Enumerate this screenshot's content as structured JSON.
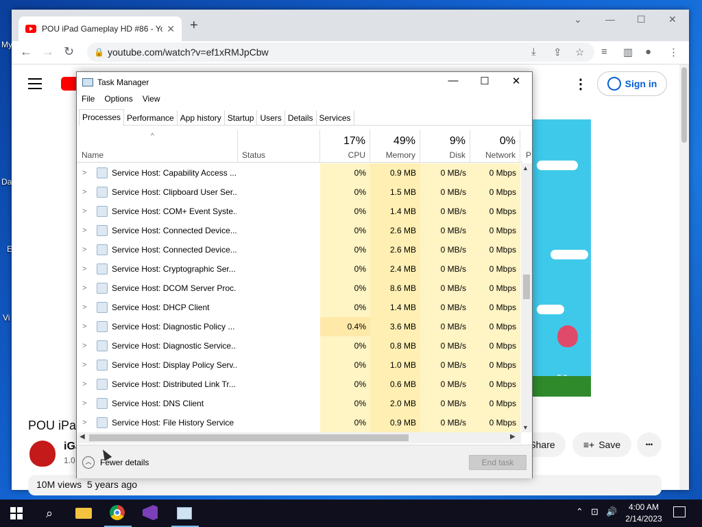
{
  "desktop": {
    "labels": [
      "My",
      "Da",
      "E",
      "Vi"
    ]
  },
  "browser": {
    "tab_title": "POU iPad Gameplay HD #86 - Yo",
    "url": "youtube.com/watch?v=ef1xRMJpCbw",
    "new_tab_symbol": "+",
    "close_symbol": "✕"
  },
  "youtube": {
    "sign_in": "Sign in",
    "video_title": "POU iPa",
    "channel_name": "iGa",
    "channel_subs": "1.0",
    "share_label": "Share",
    "save_label": "Save",
    "more_symbol": "•••",
    "views": "10M views",
    "age": "5 years ago"
  },
  "task_manager": {
    "title": "Task Manager",
    "menu": [
      "File",
      "Options",
      "View"
    ],
    "tabs": [
      "Processes",
      "Performance",
      "App history",
      "Startup",
      "Users",
      "Details",
      "Services"
    ],
    "active_tab": "Processes",
    "columns": {
      "name": "Name",
      "status": "Status",
      "cpu": {
        "pct": "17%",
        "label": "CPU"
      },
      "memory": {
        "pct": "49%",
        "label": "Memory"
      },
      "disk": {
        "pct": "9%",
        "label": "Disk"
      },
      "network": {
        "pct": "0%",
        "label": "Network"
      },
      "partial": "P"
    },
    "rows": [
      {
        "name": "Service Host: Capability Access ...",
        "cpu": "0%",
        "memory": "0.9 MB",
        "disk": "0 MB/s",
        "network": "0 Mbps"
      },
      {
        "name": "Service Host: Clipboard User Ser...",
        "cpu": "0%",
        "memory": "1.5 MB",
        "disk": "0 MB/s",
        "network": "0 Mbps"
      },
      {
        "name": "Service Host: COM+ Event Syste...",
        "cpu": "0%",
        "memory": "1.4 MB",
        "disk": "0 MB/s",
        "network": "0 Mbps"
      },
      {
        "name": "Service Host: Connected Device...",
        "cpu": "0%",
        "memory": "2.6 MB",
        "disk": "0 MB/s",
        "network": "0 Mbps"
      },
      {
        "name": "Service Host: Connected Device...",
        "cpu": "0%",
        "memory": "2.6 MB",
        "disk": "0 MB/s",
        "network": "0 Mbps"
      },
      {
        "name": "Service Host: Cryptographic Ser...",
        "cpu": "0%",
        "memory": "2.4 MB",
        "disk": "0 MB/s",
        "network": "0 Mbps"
      },
      {
        "name": "Service Host: DCOM Server Proc...",
        "cpu": "0%",
        "memory": "8.6 MB",
        "disk": "0 MB/s",
        "network": "0 Mbps"
      },
      {
        "name": "Service Host: DHCP Client",
        "cpu": "0%",
        "memory": "1.4 MB",
        "disk": "0 MB/s",
        "network": "0 Mbps"
      },
      {
        "name": "Service Host: Diagnostic Policy ...",
        "cpu": "0.4%",
        "memory": "3.6 MB",
        "disk": "0 MB/s",
        "network": "0 Mbps"
      },
      {
        "name": "Service Host: Diagnostic Service...",
        "cpu": "0%",
        "memory": "0.8 MB",
        "disk": "0 MB/s",
        "network": "0 Mbps"
      },
      {
        "name": "Service Host: Display Policy Serv...",
        "cpu": "0%",
        "memory": "1.0 MB",
        "disk": "0 MB/s",
        "network": "0 Mbps"
      },
      {
        "name": "Service Host: Distributed Link Tr...",
        "cpu": "0%",
        "memory": "0.6 MB",
        "disk": "0 MB/s",
        "network": "0 Mbps"
      },
      {
        "name": "Service Host: DNS Client",
        "cpu": "0%",
        "memory": "2.0 MB",
        "disk": "0 MB/s",
        "network": "0 Mbps"
      },
      {
        "name": "Service Host: File History Service",
        "cpu": "0%",
        "memory": "0.9 MB",
        "disk": "0 MB/s",
        "network": "0 Mbps"
      }
    ],
    "fewer_details": "Fewer details",
    "end_task": "End task"
  },
  "taskbar": {
    "time": "4:00 AM",
    "date": "2/14/2023"
  }
}
